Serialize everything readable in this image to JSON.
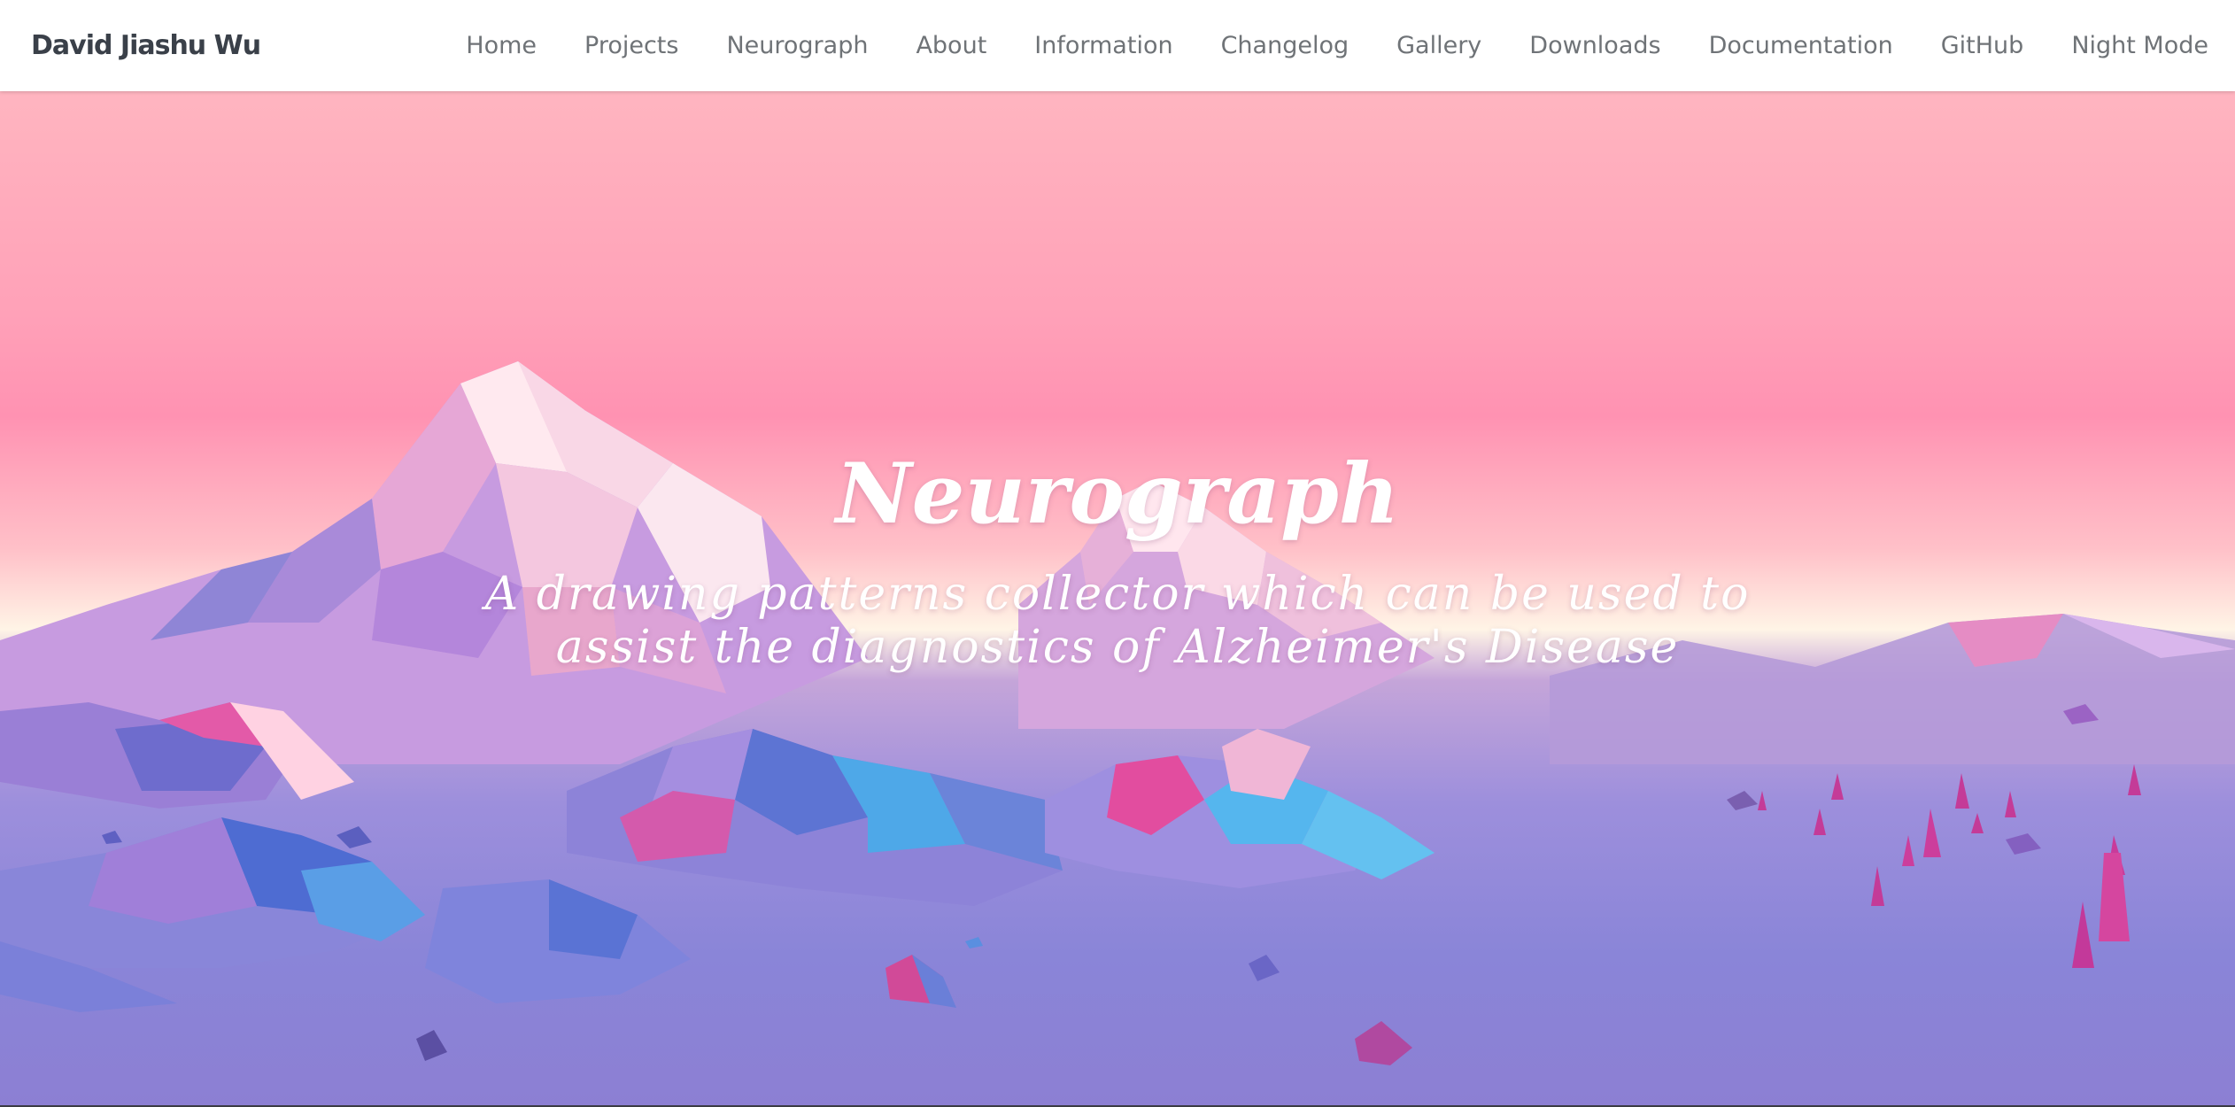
{
  "navbar": {
    "brand": "David Jiashu Wu",
    "links": [
      {
        "label": "Home"
      },
      {
        "label": "Projects"
      },
      {
        "label": "Neurograph"
      },
      {
        "label": "About"
      },
      {
        "label": "Information"
      },
      {
        "label": "Changelog"
      },
      {
        "label": "Gallery"
      },
      {
        "label": "Downloads"
      },
      {
        "label": "Documentation"
      },
      {
        "label": "GitHub"
      },
      {
        "label": "Night Mode"
      }
    ]
  },
  "hero": {
    "title": "Neurograph",
    "subtitle": "A drawing patterns collector which can be used to assist the diagnostics of Alzheimer's Disease",
    "background": "low-poly-mountain-landscape",
    "colors": {
      "sky_top": "#ffb5c0",
      "sky_mid": "#ff92b2",
      "horizon": "#fff4e6",
      "ground": "#8a85d8",
      "text": "#ffffff"
    }
  }
}
